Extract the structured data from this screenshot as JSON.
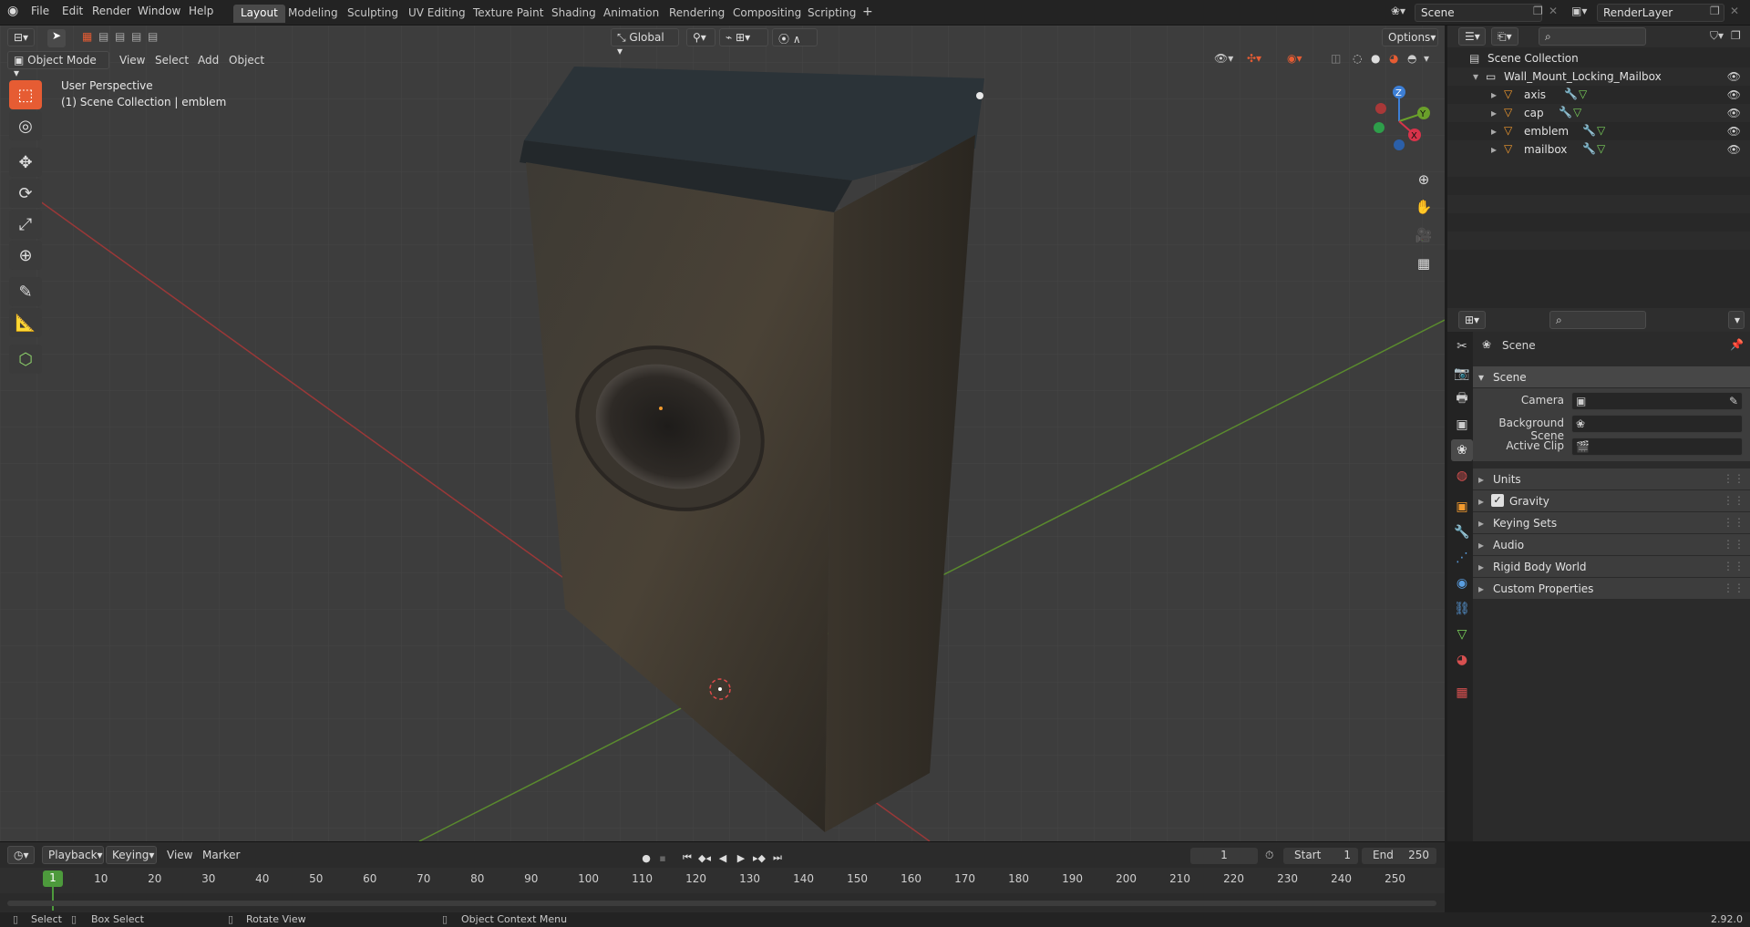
{
  "menu": {
    "items": [
      "File",
      "Edit",
      "Render",
      "Window",
      "Help"
    ]
  },
  "workspaces": [
    "Layout",
    "Modeling",
    "Sculpting",
    "UV Editing",
    "Texture Paint",
    "Shading",
    "Animation",
    "Rendering",
    "Compositing",
    "Scripting"
  ],
  "top_right": {
    "scene": "Scene",
    "render_layer": "RenderLayer"
  },
  "viewport": {
    "mode": "Object Mode",
    "menus": [
      "View",
      "Select",
      "Add",
      "Object"
    ],
    "orientation": "Global",
    "options_label": "Options",
    "perspective": "User Perspective",
    "collection_info": "(1) Scene Collection | emblem",
    "gizmo": {
      "x": "X",
      "y": "Y",
      "z": "Z"
    }
  },
  "outliner": {
    "root": "Scene Collection",
    "collection": "Wall_Mount_Locking_Mailbox",
    "objects": [
      "axis",
      "cap",
      "emblem",
      "mailbox"
    ]
  },
  "properties": {
    "header": "Scene",
    "panel_scene": "Scene",
    "fields": {
      "camera": "Camera",
      "background_scene": "Background Scene",
      "active_clip": "Active Clip"
    },
    "panels": [
      "Units",
      "Gravity",
      "Keying Sets",
      "Audio",
      "Rigid Body World",
      "Custom Properties"
    ],
    "gravity_checked": true
  },
  "timeline": {
    "menus": [
      "Playback",
      "Keying",
      "View",
      "Marker"
    ],
    "current_frame": "1",
    "start_label": "Start",
    "start": "1",
    "end_label": "End",
    "end": "250",
    "ticks": [
      "1",
      "10",
      "20",
      "30",
      "40",
      "50",
      "60",
      "70",
      "80",
      "90",
      "100",
      "110",
      "120",
      "130",
      "140",
      "150",
      "160",
      "170",
      "180",
      "190",
      "200",
      "210",
      "220",
      "230",
      "240",
      "250"
    ]
  },
  "status": {
    "select": "Select",
    "box_select": "Box Select",
    "rotate_view": "Rotate View",
    "context_menu": "Object Context Menu",
    "version": "2.92.0"
  },
  "colors": {
    "accent": "#e65c33",
    "x_axis": "#d8334a",
    "y_axis": "#6aa02a",
    "z_axis": "#3d7fd6"
  }
}
